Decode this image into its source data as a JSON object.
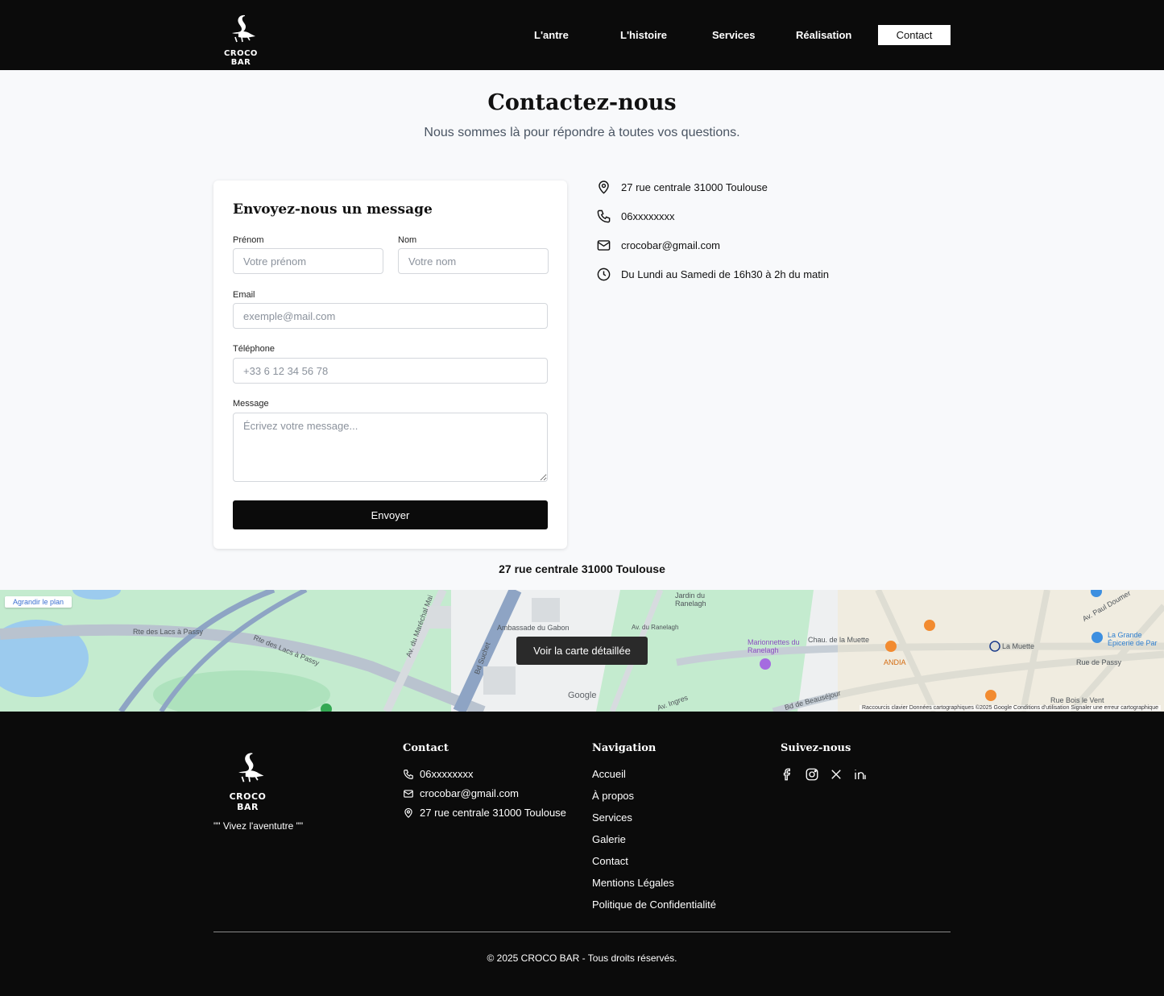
{
  "header": {
    "brand": "CROCO BAR",
    "nav": [
      {
        "label": "L'antre"
      },
      {
        "label": "L'histoire"
      },
      {
        "label": "Services"
      },
      {
        "label": "Réalisation"
      },
      {
        "label": "Contact",
        "active": true
      }
    ]
  },
  "hero": {
    "title": "Contactez-nous",
    "subtitle": "Nous sommes là pour répondre à toutes vos questions."
  },
  "form": {
    "title": "Envoyez-nous un message",
    "first_name_label": "Prénom",
    "first_name_placeholder": "Votre prénom",
    "last_name_label": "Nom",
    "last_name_placeholder": "Votre nom",
    "email_label": "Email",
    "email_placeholder": "exemple@mail.com",
    "phone_label": "Téléphone",
    "phone_placeholder": "+33 6 12 34 56 78",
    "message_label": "Message",
    "message_placeholder": "Écrivez votre message...",
    "submit_label": "Envoyer"
  },
  "info": {
    "address": "27 rue centrale 31000 Toulouse",
    "phone": "06xxxxxxxx",
    "email": "crocobar@gmail.com",
    "hours": "Du Lundi au Samedi de 16h30 à 2h du matin"
  },
  "map": {
    "caption": "27 rue centrale 31000 Toulouse",
    "enlarge_label": "Agrandir le plan",
    "detail_label": "Voir la carte détaillée",
    "labels": {
      "rte_lacs_1": "Rte des Lacs à Passy",
      "rte_lacs_2": "Rte des Lacs à Passy",
      "marechal": "Av. du Maréchal Mai",
      "suchet": "Bd Suchet",
      "gabon": "Ambassade du Gabon",
      "ranelagh_av": "Av. du Ranelagh",
      "jardin": "Jardin du Ranelagh",
      "marionnettes": "Marionnettes du Ranelagh",
      "muette_chau": "Chau. de la Muette",
      "andia": "ANDIA",
      "la_muette": "La Muette",
      "grande_epicerie": "La Grande Épicerie de Par",
      "rue_passy": "Rue de Passy",
      "paul_doumer": "Av. Paul Doumer",
      "ingres": "Av. Ingres",
      "beausejour": "Bd de Beauséjour",
      "bois_vent": "Rue Bois le Vent",
      "google": "Google"
    },
    "attribution": "Raccourcis clavier   Données cartographiques ©2025 Google   Conditions d'utilisation   Signaler une erreur cartographique"
  },
  "footer": {
    "brand": "CROCO BAR",
    "tagline": "\"\" Vivez l'aventutre \"\"",
    "contact_title": "Contact",
    "contact_phone": "06xxxxxxxx",
    "contact_email": "crocobar@gmail.com",
    "contact_address": "27 rue centrale 31000 Toulouse",
    "nav_title": "Navigation",
    "nav_links": [
      "Accueil",
      "À propos",
      "Services",
      "Galerie",
      "Contact",
      "Mentions Légales",
      "Politique de Confidentialité"
    ],
    "social_title": "Suivez-nous",
    "social_icons": [
      "facebook-icon",
      "instagram-icon",
      "x-icon",
      "linkedin-icon"
    ],
    "copyright": "© 2025 CROCO BAR - Tous droits réservés."
  },
  "colors": {
    "header_bg": "#0b0b0b",
    "page_bg": "#f8f9fb",
    "park_green": "#bfe9c9",
    "water_blue": "#9ccbee",
    "road_blue": "#8ea4c4"
  }
}
